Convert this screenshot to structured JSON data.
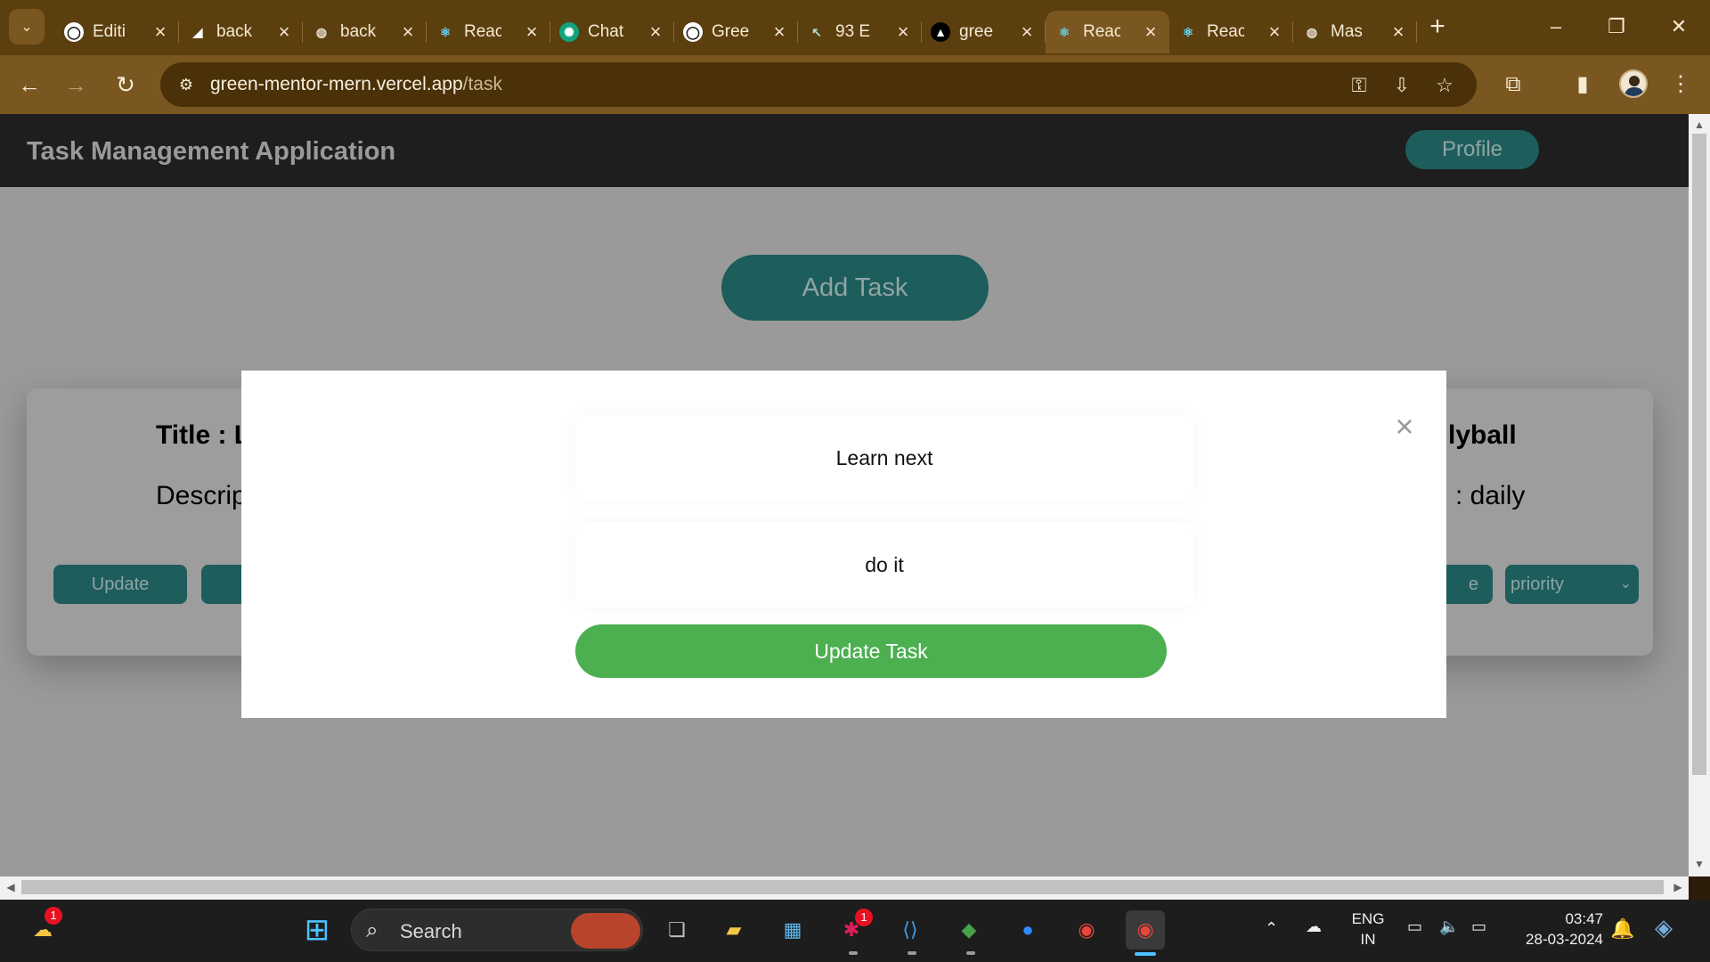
{
  "browser": {
    "tabs": [
      {
        "label": "Editi",
        "icon": "github-icon"
      },
      {
        "label": "back",
        "icon": "render-icon"
      },
      {
        "label": "back",
        "icon": "globe-icon"
      },
      {
        "label": "Reac",
        "icon": "react-icon"
      },
      {
        "label": "Chat",
        "icon": "chatgpt-icon"
      },
      {
        "label": "Gree",
        "icon": "github-icon"
      },
      {
        "label": "93 E",
        "icon": "cursor-icon"
      },
      {
        "label": "gree",
        "icon": "vercel-icon"
      },
      {
        "label": "Reac",
        "icon": "react-icon",
        "active": true
      },
      {
        "label": "Reac",
        "icon": "react-icon"
      },
      {
        "label": "Mas",
        "icon": "globe-icon"
      }
    ],
    "url_host": "green-mentor-mern.vercel.app",
    "url_path": "/task"
  },
  "app": {
    "title": "Task Management Application",
    "profile_label": "Profile",
    "add_task_label": "Add Task"
  },
  "card": {
    "title_left": "Title : L",
    "desc_left": "Descrip",
    "title_right": "lyball",
    "desc_right": ": daily",
    "update_label": "Update",
    "right_btn_label": "e",
    "priority_label": "priority"
  },
  "modal": {
    "close_glyph": "×",
    "title_value": "Learn next",
    "description_value": "do it",
    "submit_label": "Update Task"
  },
  "taskbar": {
    "search_label": "Search",
    "weather_badge": "1",
    "slack_badge": "1",
    "lang_line1": "ENG",
    "lang_line2": "IN",
    "time": "03:47",
    "date": "28-03-2024"
  },
  "colors": {
    "accent_teal": "#1d5d5b",
    "update_green": "#4caf50",
    "browser_frame": "#5c3f0f"
  }
}
